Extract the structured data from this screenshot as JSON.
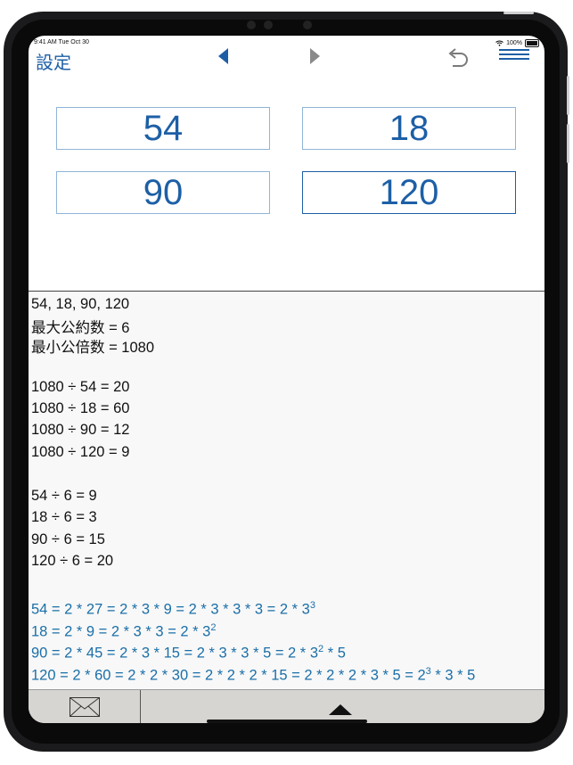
{
  "status_bar": {
    "time": "9:41 AM  Tue Oct 30",
    "battery": "100%"
  },
  "toolbar": {
    "settings_label": "設定",
    "back_icon": "triangle-left-icon",
    "forward_icon": "triangle-right-icon",
    "undo_icon": "undo-arrow-icon",
    "menu_icon": "hamburger-menu-icon"
  },
  "inputs": [
    "54",
    "18",
    "90",
    "120"
  ],
  "result": {
    "header": "54, 18, 90, 120",
    "gcd_line": "最大公約数 = 6",
    "lcm_line": "最小公倍数 = 1080",
    "lcm_divisions": [
      "1080 ÷ 54 = 20",
      "1080 ÷ 18 = 60",
      "1080 ÷ 90 = 12",
      "1080 ÷ 120 = 9"
    ],
    "gcd_divisions": [
      "54 ÷ 6 = 9",
      "18 ÷ 6 = 3",
      "90 ÷ 6 = 15",
      "120 ÷ 6 = 20"
    ],
    "factorizations": [
      {
        "base": "54 = 2 * 27 = 2 * 3 * 9 = 2 * 3 * 3 * 3 = 2 * 3",
        "exp1": "3",
        "tail": ""
      },
      {
        "base": "18 = 2 * 9 = 2 * 3 * 3 = 2 * 3",
        "exp1": "2",
        "tail": ""
      },
      {
        "base": "90 = 2 * 45 = 2 * 3 * 15 = 2 * 3 * 3 * 5 = 2 * 3",
        "exp1": "2",
        "tail": " * 5"
      },
      {
        "base": "120 = 2 * 60 = 2 * 2 * 30 = 2 * 2 * 2 * 15 = 2 * 2 * 2 * 3 * 5 = 2",
        "exp1": "3",
        "tail": " * 3 * 5"
      }
    ]
  },
  "bottom_bar": {
    "mail_icon": "envelope-icon",
    "expand_icon": "triangle-up-icon"
  },
  "colors": {
    "accent": "#1d5fa6",
    "factor_text": "#1b6fa8"
  }
}
